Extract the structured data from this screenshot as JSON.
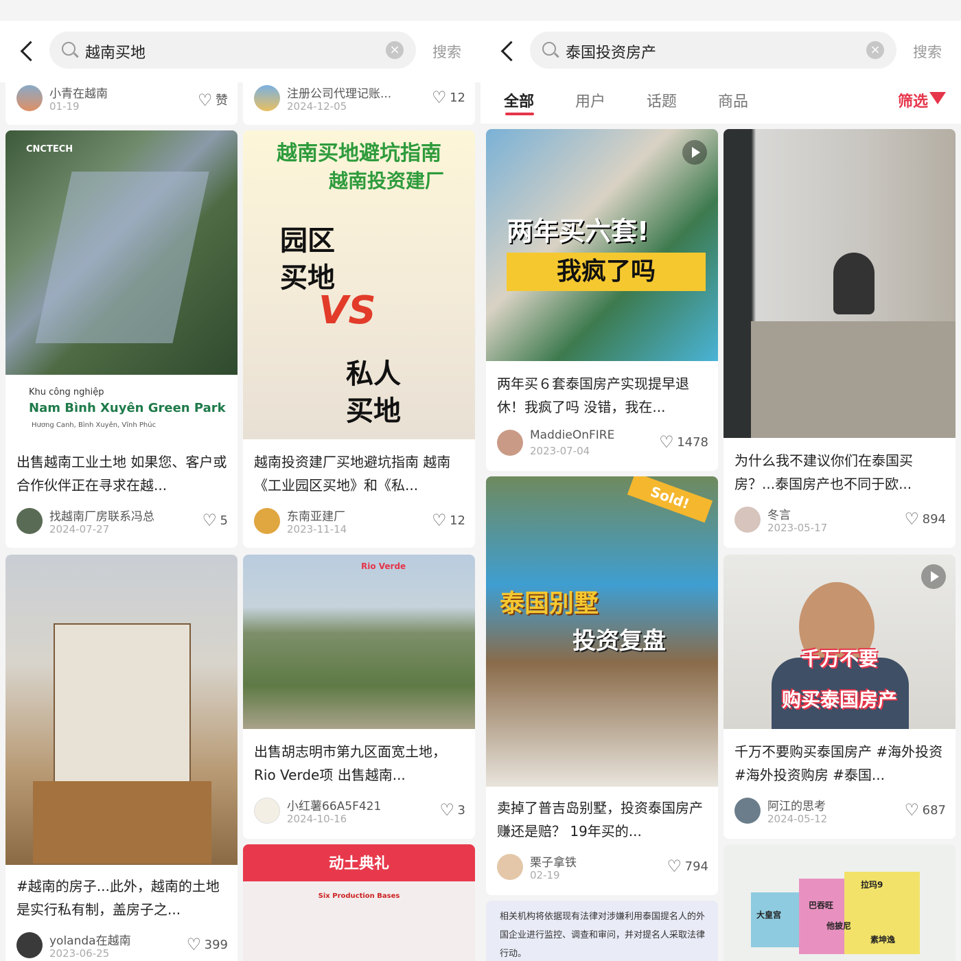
{
  "left": {
    "search": {
      "query": "越南买地",
      "button": "搜索"
    },
    "top_row": [
      {
        "author": "小青在越南",
        "date": "01-19",
        "likes": "赞"
      },
      {
        "author": "注册公司代理记账...",
        "date": "2024-12-05",
        "likes": "12"
      }
    ],
    "cards": [
      {
        "image_text": {
          "brand": "CNCTECH",
          "sub": "Khu công nghiệp",
          "name": "Nam Bình Xuyên Green Park",
          "addr": "Hương Canh, Bình Xuyên, Vĩnh Phúc"
        },
        "title": "出售越南工业土地 如果您、客户或合作伙伴正在寻求在越...",
        "author": "找越南厂房联系冯总",
        "date": "2024-07-27",
        "likes": "5"
      },
      {
        "image_text": {
          "line1": "越南买地避坑指南",
          "line2": "越南投资建厂",
          "a": "园区",
          "b": "买地",
          "vs": "VS",
          "c": "私人",
          "d": "买地"
        },
        "title": "越南投资建厂买地避坑指南 越南《工业园区买地》和《私...",
        "author": "东南亚建厂",
        "date": "2023-11-14",
        "likes": "12"
      },
      {
        "title": "#越南的房子...此外，越南的土地是实行私有制，盖房子之...",
        "author": "yolanda在越南",
        "date": "2023-06-25",
        "likes": "399"
      },
      {
        "image_text": {
          "label": "Rio Verde"
        },
        "title": "出售胡志明市第九区面宽土地，Rio Verde项 出售越南...",
        "author": "小红薯66A5F421",
        "date": "2024-10-16",
        "likes": "3"
      },
      {
        "image_text": {
          "heading": "动土典礼",
          "sub": "Six Production Bases"
        }
      }
    ]
  },
  "right": {
    "search": {
      "query": "泰国投资房产",
      "button": "搜索"
    },
    "tabs": [
      "全部",
      "用户",
      "话题",
      "商品"
    ],
    "filter": "筛选",
    "cards": [
      {
        "image_text": {
          "line1": "两年买六套!",
          "line2": "我疯了吗"
        },
        "title": "两年买６套泰国房产实现提早退休！我疯了吗 没错，我在...",
        "author": "MaddieOnFIRE",
        "date": "2023-07-04",
        "likes": "1478"
      },
      {
        "title": "为什么我不建议你们在泰国买房？...泰国房产也不同于欧...",
        "author": "冬言",
        "date": "2023-05-17",
        "likes": "894"
      },
      {
        "image_text": {
          "sold": "Sold!",
          "line1": "泰国别墅",
          "line2": "投资复盘"
        },
        "title": "卖掉了普吉岛别墅，投资泰国房产赚还是赔？ 19年买的...",
        "author": "栗子拿铁",
        "date": "02-19",
        "likes": "794"
      },
      {
        "image_text": {
          "line1": "千万不要",
          "line2": "购买泰国房产"
        },
        "title": "千万不要购买泰国房产 #海外投资 #海外投资购房 #泰国...",
        "author": "阿江的思考",
        "date": "2024-05-12",
        "likes": "687"
      },
      {
        "image_text": {
          "text": "相关机构将依据现有法律对涉嫌利用泰国提名人的外国企业进行监控、调查和审问，并对提名人采取法律行动。"
        }
      },
      {
        "image_text": {
          "a": "拉玛9",
          "b": "大皇宫",
          "c": "巴吞旺",
          "d": "他披尼",
          "e": "素坤逸"
        }
      }
    ]
  },
  "colors": {
    "accent": "#e6354a",
    "green": "#1e7a4a"
  }
}
